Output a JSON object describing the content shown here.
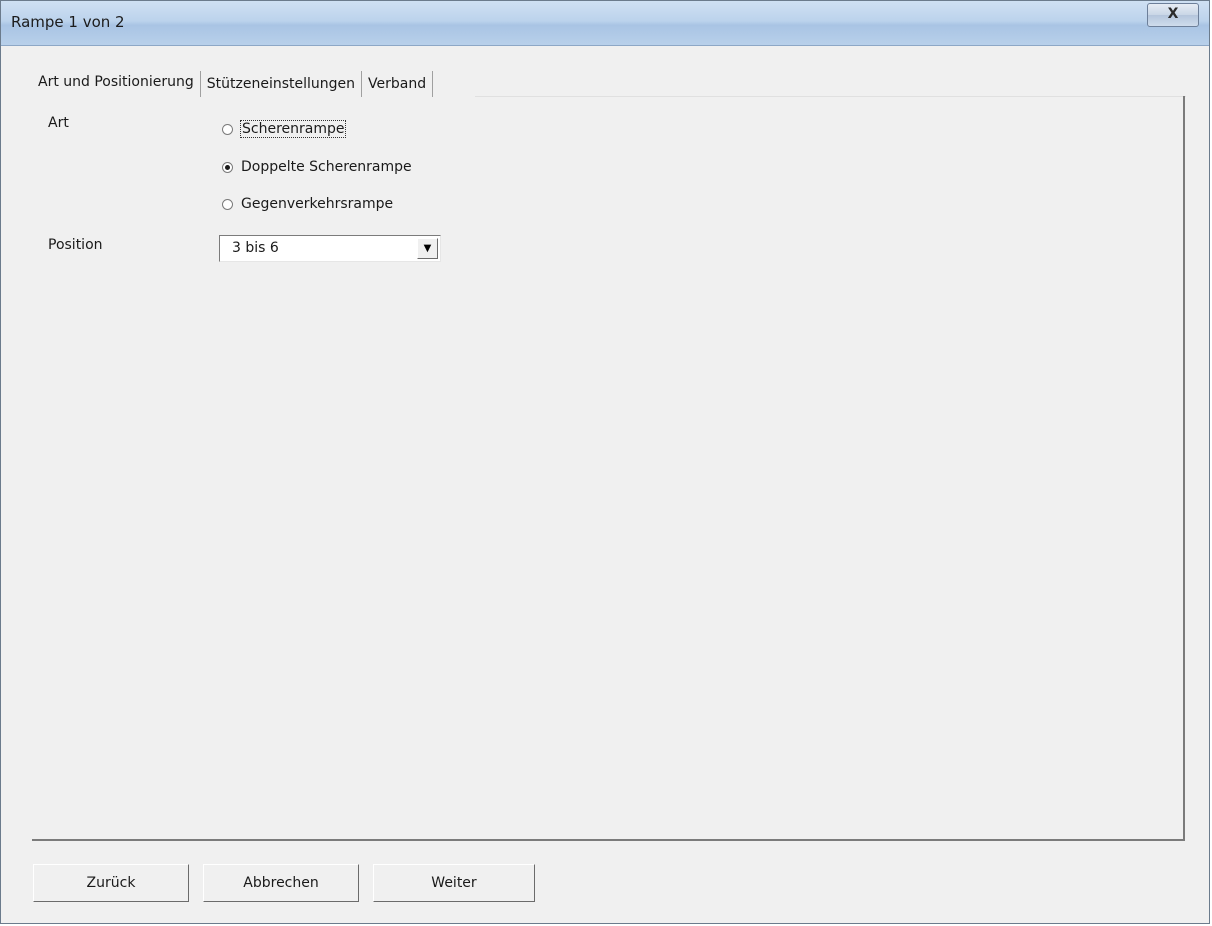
{
  "window": {
    "title": "Rampe 1 von 2",
    "close_label": "X"
  },
  "tabs": [
    {
      "label": "Art und Positionierung",
      "active": true
    },
    {
      "label": "Stützeneinstellungen",
      "active": false
    },
    {
      "label": "Verband",
      "active": false
    }
  ],
  "form": {
    "art_label": "Art",
    "art_options": [
      {
        "label": "Scherenrampe",
        "checked": false
      },
      {
        "label": "Doppelte Scherenrampe",
        "checked": true
      },
      {
        "label": "Gegenverkehrsrampe",
        "checked": false
      }
    ],
    "position_label": "Position",
    "position_value": "3 bis 6"
  },
  "buttons": {
    "back": "Zurück",
    "cancel": "Abbrechen",
    "next": "Weiter"
  }
}
